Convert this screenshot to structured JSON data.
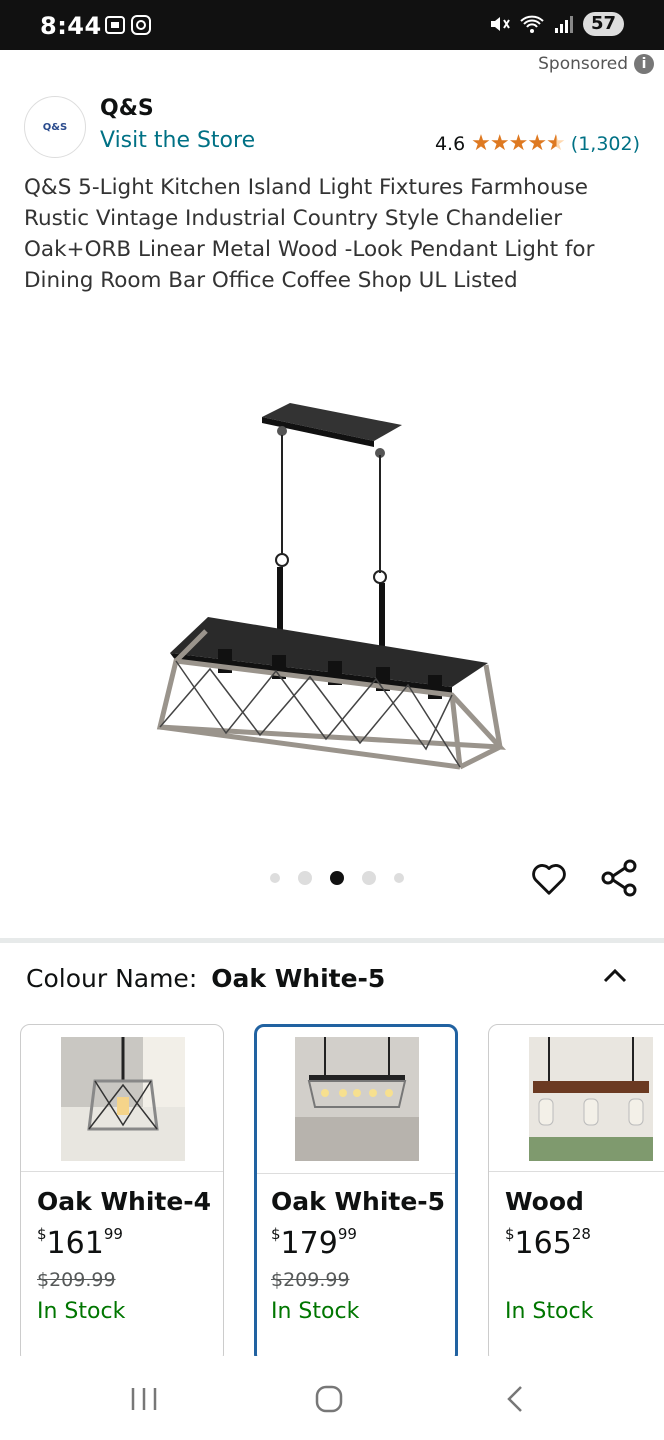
{
  "status_bar": {
    "time": "8:44",
    "battery": "57"
  },
  "ad": {
    "sponsored_label": "Sponsored"
  },
  "brand": {
    "logo_text": "Q&S",
    "name": "Q&S",
    "visit_store": "Visit the Store"
  },
  "rating": {
    "score": "4.6",
    "count": "(1,302)"
  },
  "product": {
    "title": "Q&S 5-Light Kitchen Island Light Fixtures Farmhouse Rustic Vintage Industrial Country Style Chandelier Oak+ORB Linear Metal Wood -Look Pendant Light for Dining Room Bar Office Coffee Shop UL Listed",
    "image_count": 5,
    "active_image_index": 2
  },
  "colour": {
    "label": "Colour Name:",
    "selected": "Oak White-5"
  },
  "variants": [
    {
      "name": "Oak White-4",
      "price_whole": "161",
      "price_fraction": "99",
      "currency": "$",
      "list_price": "$209.99",
      "availability": "In Stock",
      "selected": false
    },
    {
      "name": "Oak White-5",
      "price_whole": "179",
      "price_fraction": "99",
      "currency": "$",
      "list_price": "$209.99",
      "availability": "In Stock",
      "selected": true
    },
    {
      "name": "Wood",
      "price_whole": "165",
      "price_fraction": "28",
      "currency": "$",
      "list_price": "",
      "availability": "In Stock",
      "selected": false
    }
  ],
  "colors": {
    "link": "#007185",
    "star": "#de7921",
    "in_stock": "#007600",
    "selected_border": "#2162a1"
  },
  "icons": [
    "info-icon",
    "star-icon",
    "heart-icon",
    "share-icon",
    "chevron-up-icon",
    "nav-recents-icon",
    "nav-home-icon",
    "nav-back-icon"
  ]
}
